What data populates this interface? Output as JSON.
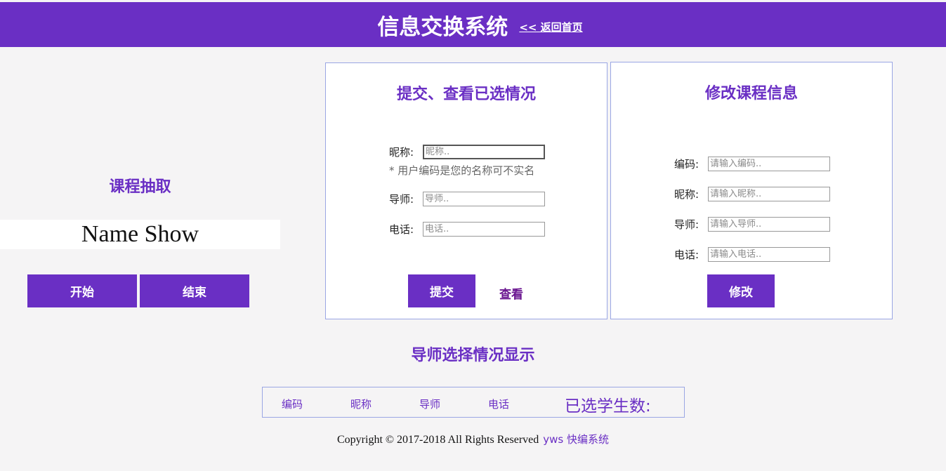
{
  "header": {
    "title": "信息交换系统",
    "back_link": "<< 返回首页"
  },
  "draw": {
    "title": "课程抽取",
    "name_display": "Name Show",
    "start_label": "开始",
    "stop_label": "结束"
  },
  "submit_card": {
    "title": "提交、查看已选情况",
    "nickname_label": "昵称:",
    "nickname_placeholder": "昵称..",
    "hint": "* 用户编码是您的名称可不实名",
    "advisor_label": "导师:",
    "advisor_placeholder": "导师..",
    "phone_label": "电话:",
    "phone_placeholder": "电话..",
    "submit_label": "提交",
    "view_label": "查看"
  },
  "edit_card": {
    "title": "修改课程信息",
    "code_label": "编码:",
    "code_placeholder": "请输入编码..",
    "nickname_label": "昵称:",
    "nickname_placeholder": "请输入昵称..",
    "advisor_label": "导师:",
    "advisor_placeholder": "请输入导师..",
    "phone_label": "电话:",
    "phone_placeholder": "请输入电话..",
    "edit_label": "修改"
  },
  "selection": {
    "title": "导师选择情况显示",
    "columns": [
      "编码",
      "昵称",
      "导师",
      "电话",
      "已选学生数:"
    ]
  },
  "footer": {
    "copyright": "Copyright © 2017-2018  All Rights Reserved",
    "brand": "yws 快编系统"
  },
  "colors": {
    "accent": "#6a2fc4",
    "border": "#9aa6e4",
    "background": "#f5f4f5"
  }
}
